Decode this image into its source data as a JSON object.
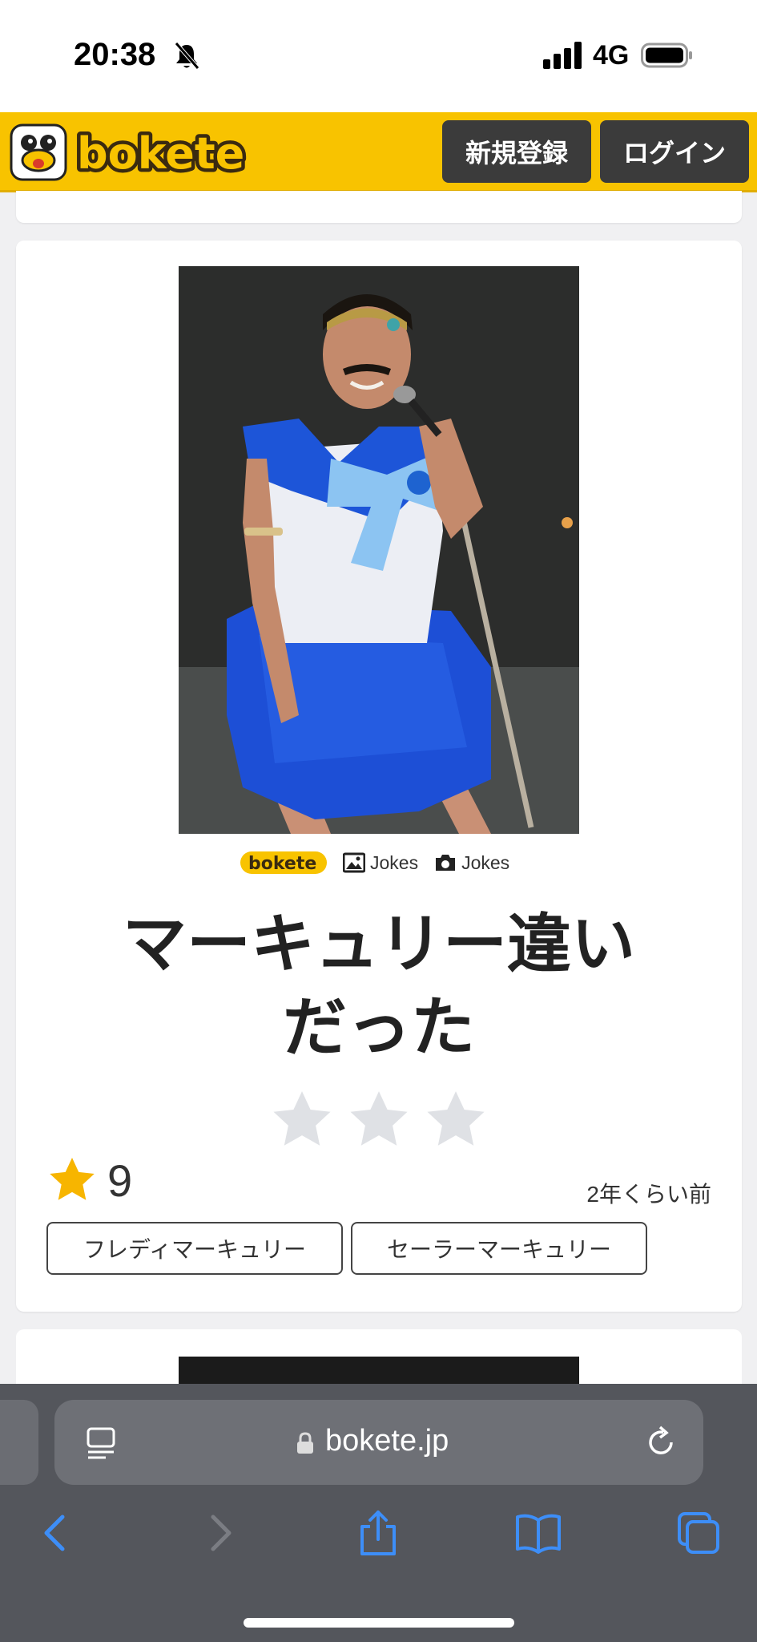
{
  "status_bar": {
    "time": "20:38",
    "network": "4G",
    "icons": [
      "bell-muted-icon",
      "signal-icon",
      "battery-icon"
    ]
  },
  "header": {
    "logo_text": "bokete",
    "register_label": "新規登録",
    "login_label": "ログイン"
  },
  "post": {
    "credits": [
      {
        "icon": "bokete-mini-logo",
        "text": ""
      },
      {
        "icon": "image-icon",
        "text": "Jokes"
      },
      {
        "icon": "camera-icon",
        "text": "Jokes"
      }
    ],
    "caption_line1": "マーキュリー違い",
    "caption_line2": "だった",
    "rating_stars": 3,
    "score": "9",
    "time_ago": "2年くらい前",
    "tags": [
      "フレディマーキュリー",
      "セーラーマーキュリー"
    ]
  },
  "browser": {
    "url": "bokete.jp"
  },
  "colors": {
    "brand_yellow": "#f8c300",
    "dark_button": "#3b3b3b",
    "star_gold": "#f7b500",
    "star_gray": "#dfe1e5",
    "toolbar_blue": "#3d8ef8"
  }
}
